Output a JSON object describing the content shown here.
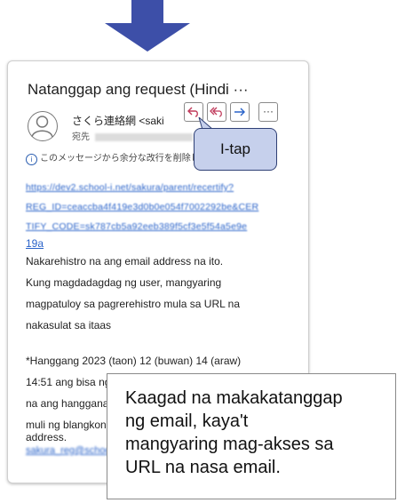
{
  "mail": {
    "subject": "Natanggap ang request (Hindi ···",
    "sender": "さくら連絡網 <saki",
    "recipient_label": "宛先",
    "info_notice": "このメッセージから余分な改行を削除しま",
    "link_lines": [
      "https://dev2.school-i.net/sakura/parent/recertify?",
      "REG_ID=ceaccba4f419e3d0b0e054f7002292be&CER",
      "TIFY_CODE=sk787cb5a92eeb389f5cf3e5f54a5e9e"
    ],
    "link_end": "19a",
    "body_lines": [
      "Nakarehistro na ang email address na ito.",
      "Kung magdadagdag ng user, mangyaring",
      "magpatuloy sa pagrerehistro mula sa URL na",
      "nakasulat sa itaas"
    ],
    "deadline_lines": [
      "*Hanggang 2023 (taon) 12 (buwan) 14 (araw)",
      "14:51 ang bisa ng pagrerehistro.  *Kung lumipas",
      "na ang hangganan, mangyaring gumawa",
      "muli ng blangkong email sa",
      "address."
    ],
    "blurred_email": "sakura_reg@school-i.net"
  },
  "actions": {
    "reply_icon": "reply-icon",
    "reply_all_icon": "reply-all-icon",
    "forward_icon": "forward-icon",
    "more_label": "···"
  },
  "callout": {
    "tap_label": "I-tap"
  },
  "note": {
    "lines": [
      "Kaagad na makakatanggap",
      "ng email, kaya't",
      "mangyaring mag-akses sa",
      "URL na nasa email."
    ]
  },
  "colors": {
    "arrow": "#3d4fa8",
    "link": "#2a63c9",
    "action_icon": "#c0395a",
    "forward_icon": "#2a63c9",
    "callout_fill": "#c6d0ec",
    "callout_border": "#2e3f75"
  }
}
